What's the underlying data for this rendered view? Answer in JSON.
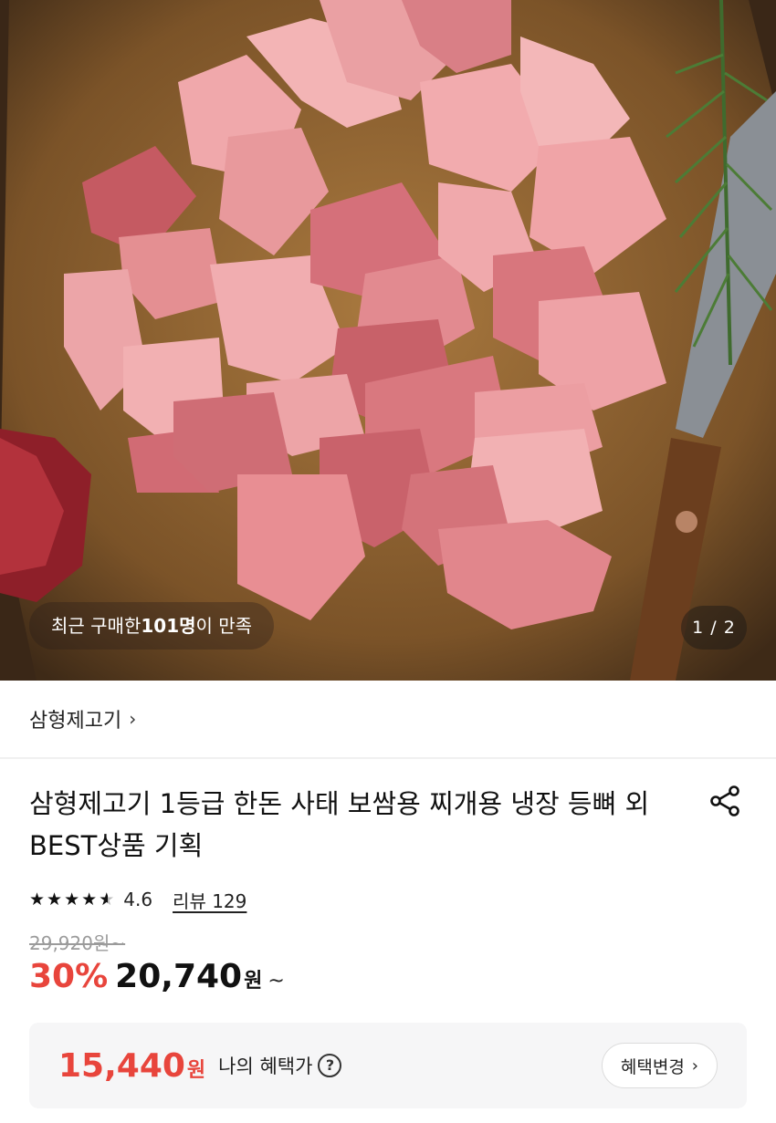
{
  "hero": {
    "badge_prefix": "최근 구매한 ",
    "badge_count": "101명",
    "badge_suffix": "이 만족",
    "page_indicator": "1 / 2"
  },
  "brand": {
    "name": "삼형제고기",
    "chevron": "›"
  },
  "product": {
    "title": "삼형제고기 1등급 한돈 사태 보쌈용 찌개용 냉장 등뼈 외 BEST상품 기획",
    "rating": "4.6",
    "review_label": "리뷰 129",
    "original_price": "29,920원~",
    "discount": "30%",
    "sale_price": "20,740",
    "won": "원",
    "tilde": "~"
  },
  "benefit": {
    "price": "15,440",
    "won": "원",
    "label": "나의 혜택가",
    "help": "?",
    "button_label": "혜택변경",
    "button_chevron": "›"
  },
  "colors": {
    "accent_red": "#e8453c",
    "strike_gray": "#9b9b9b"
  },
  "icons": {
    "share": "share-icon",
    "help": "question-circle-icon",
    "star": "star-icon"
  }
}
